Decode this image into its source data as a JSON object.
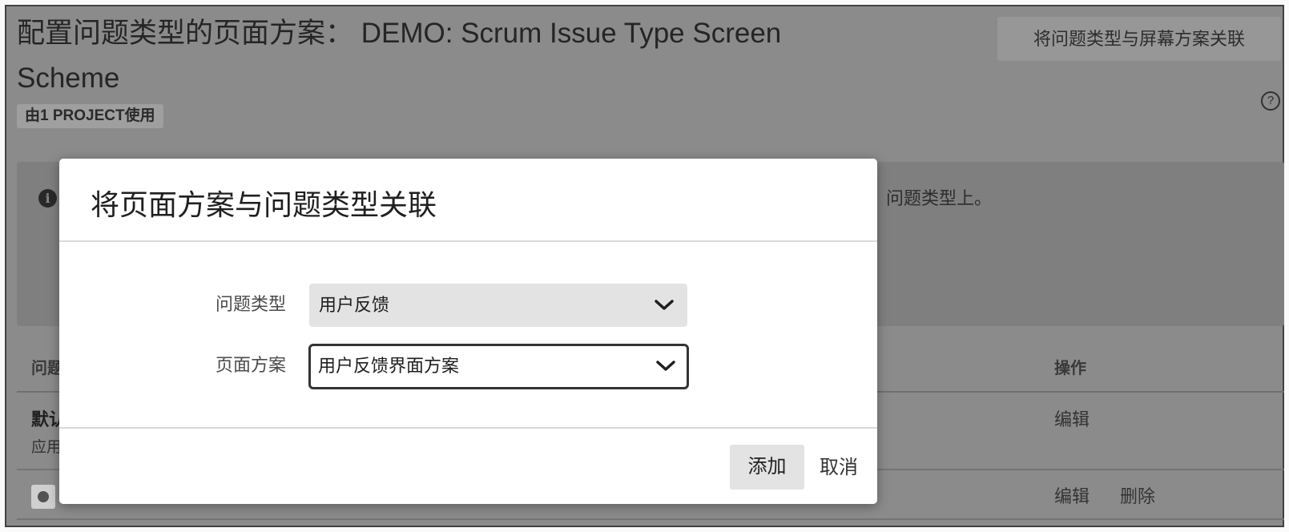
{
  "page": {
    "title": "配置问题类型的页面方案： DEMO: Scrum Issue Type Screen Scheme",
    "badge": "由1 PROJECT使用",
    "associate_button": "将问题类型与屏幕方案关联",
    "info": {
      "text": "问题类型上。"
    },
    "table": {
      "headers": {
        "issue_type": "问题",
        "actions": "操作"
      },
      "rows": [
        {
          "name": "默认",
          "sub": "应用",
          "actions": [
            "编辑"
          ]
        },
        {
          "icon": "issue-type-icon",
          "actions": [
            "编辑",
            "删除"
          ]
        }
      ]
    }
  },
  "dialog": {
    "title": "将页面方案与问题类型关联",
    "fields": [
      {
        "label": "问题类型",
        "value": "用户反馈"
      },
      {
        "label": "页面方案",
        "value": "用户反馈界面方案"
      }
    ],
    "add_button": "添加",
    "cancel_link": "取消"
  },
  "icons": {
    "help": "help-icon",
    "info": "info-icon",
    "select_arrow": "chevron-down-icon",
    "row_type": "issue-type-icon"
  },
  "colors": {
    "page_dimmed_bg": "#8e8e8e",
    "info_panel": "#828282",
    "dialog_bg": "#ffffff",
    "focus_border": "#333333",
    "select_bg": "#e3e3e3"
  }
}
